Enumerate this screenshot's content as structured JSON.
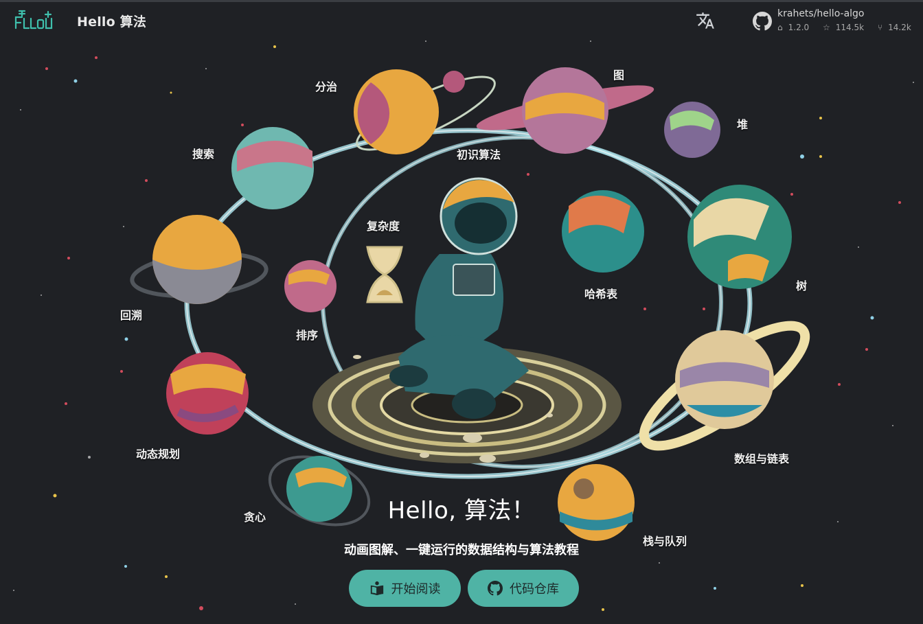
{
  "header": {
    "logo_icon": "hello-algo-logo",
    "title": "Hello 算法",
    "language_icon": "translate-icon",
    "repo": {
      "icon": "github-icon",
      "name": "krahets/hello-algo",
      "version": "1.2.0",
      "stars": "114.5k",
      "forks": "14.2k"
    }
  },
  "hero": {
    "title": "Hello, 算法！",
    "subtitle": "动画图解、一键运行的数据结构与算法教程",
    "start_button": "开始阅读",
    "repo_button": "代码仓库"
  },
  "chapters": {
    "divide": "分治",
    "graph": "图",
    "heap": "堆",
    "search": "搜索",
    "intro": "初识算法",
    "complexity": "复杂度",
    "hashing": "哈希表",
    "tree": "树",
    "backtracking": "回溯",
    "sorting": "排序",
    "dp": "动态规划",
    "array": "数组与链表",
    "greedy": "贪心",
    "stack": "栈与队列"
  },
  "colors": {
    "background": "#1f2125",
    "accent": "#4fb3a5",
    "logo": "#3fc0ad"
  }
}
